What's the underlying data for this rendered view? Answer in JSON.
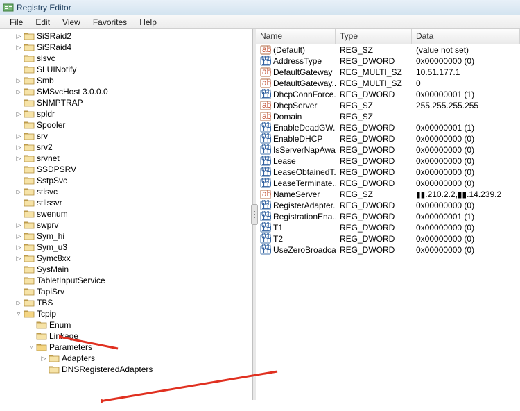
{
  "window": {
    "title": "Registry Editor"
  },
  "menu": [
    "File",
    "Edit",
    "View",
    "Favorites",
    "Help"
  ],
  "tree": [
    {
      "indent": 1,
      "exp": "▷",
      "label": "SiSRaid2"
    },
    {
      "indent": 1,
      "exp": "▷",
      "label": "SiSRaid4"
    },
    {
      "indent": 1,
      "exp": "",
      "label": "slsvc"
    },
    {
      "indent": 1,
      "exp": "",
      "label": "SLUINotify"
    },
    {
      "indent": 1,
      "exp": "▷",
      "label": "Smb"
    },
    {
      "indent": 1,
      "exp": "▷",
      "label": "SMSvcHost 3.0.0.0"
    },
    {
      "indent": 1,
      "exp": "",
      "label": "SNMPTRAP"
    },
    {
      "indent": 1,
      "exp": "▷",
      "label": "spldr"
    },
    {
      "indent": 1,
      "exp": "",
      "label": "Spooler"
    },
    {
      "indent": 1,
      "exp": "▷",
      "label": "srv"
    },
    {
      "indent": 1,
      "exp": "▷",
      "label": "srv2"
    },
    {
      "indent": 1,
      "exp": "▷",
      "label": "srvnet"
    },
    {
      "indent": 1,
      "exp": "",
      "label": "SSDPSRV"
    },
    {
      "indent": 1,
      "exp": "",
      "label": "SstpSvc"
    },
    {
      "indent": 1,
      "exp": "▷",
      "label": "stisvc"
    },
    {
      "indent": 1,
      "exp": "",
      "label": "stllssvr"
    },
    {
      "indent": 1,
      "exp": "",
      "label": "swenum"
    },
    {
      "indent": 1,
      "exp": "▷",
      "label": "swprv"
    },
    {
      "indent": 1,
      "exp": "▷",
      "label": "Sym_hi"
    },
    {
      "indent": 1,
      "exp": "▷",
      "label": "Sym_u3"
    },
    {
      "indent": 1,
      "exp": "▷",
      "label": "Symc8xx"
    },
    {
      "indent": 1,
      "exp": "",
      "label": "SysMain"
    },
    {
      "indent": 1,
      "exp": "",
      "label": "TabletInputService"
    },
    {
      "indent": 1,
      "exp": "",
      "label": "TapiSrv"
    },
    {
      "indent": 1,
      "exp": "▷",
      "label": "TBS"
    },
    {
      "indent": 1,
      "exp": "▿",
      "label": "Tcpip",
      "open": true
    },
    {
      "indent": 2,
      "exp": "",
      "label": "Enum"
    },
    {
      "indent": 2,
      "exp": "",
      "label": "Linkage"
    },
    {
      "indent": 2,
      "exp": "▿",
      "label": "Parameters",
      "open": true
    },
    {
      "indent": 3,
      "exp": "▷",
      "label": "Adapters"
    },
    {
      "indent": 3,
      "exp": "",
      "label": "DNSRegisteredAdapters"
    }
  ],
  "columns": {
    "name": "Name",
    "type": "Type",
    "data": "Data"
  },
  "values": [
    {
      "kind": "sz",
      "name": "(Default)",
      "type": "REG_SZ",
      "data": "(value not set)"
    },
    {
      "kind": "bin",
      "name": "AddressType",
      "type": "REG_DWORD",
      "data": "0x00000000 (0)"
    },
    {
      "kind": "sz",
      "name": "DefaultGateway",
      "type": "REG_MULTI_SZ",
      "data": "10.51.177.1"
    },
    {
      "kind": "sz",
      "name": "DefaultGateway...",
      "type": "REG_MULTI_SZ",
      "data": "0"
    },
    {
      "kind": "bin",
      "name": "DhcpConnForce...",
      "type": "REG_DWORD",
      "data": "0x00000001 (1)"
    },
    {
      "kind": "sz",
      "name": "DhcpServer",
      "type": "REG_SZ",
      "data": "255.255.255.255"
    },
    {
      "kind": "sz",
      "name": "Domain",
      "type": "REG_SZ",
      "data": ""
    },
    {
      "kind": "bin",
      "name": "EnableDeadGW...",
      "type": "REG_DWORD",
      "data": "0x00000001 (1)"
    },
    {
      "kind": "bin",
      "name": "EnableDHCP",
      "type": "REG_DWORD",
      "data": "0x00000000 (0)"
    },
    {
      "kind": "bin",
      "name": "IsServerNapAware",
      "type": "REG_DWORD",
      "data": "0x00000000 (0)"
    },
    {
      "kind": "bin",
      "name": "Lease",
      "type": "REG_DWORD",
      "data": "0x00000000 (0)"
    },
    {
      "kind": "bin",
      "name": "LeaseObtainedT...",
      "type": "REG_DWORD",
      "data": "0x00000000 (0)"
    },
    {
      "kind": "bin",
      "name": "LeaseTerminate...",
      "type": "REG_DWORD",
      "data": "0x00000000 (0)"
    },
    {
      "kind": "sz",
      "name": "NameServer",
      "type": "REG_SZ",
      "data": "▮▮.210.2.2,▮▮.14.239.2"
    },
    {
      "kind": "bin",
      "name": "RegisterAdapter...",
      "type": "REG_DWORD",
      "data": "0x00000000 (0)"
    },
    {
      "kind": "bin",
      "name": "RegistrationEna...",
      "type": "REG_DWORD",
      "data": "0x00000001 (1)"
    },
    {
      "kind": "bin",
      "name": "T1",
      "type": "REG_DWORD",
      "data": "0x00000000 (0)"
    },
    {
      "kind": "bin",
      "name": "T2",
      "type": "REG_DWORD",
      "data": "0x00000000 (0)"
    },
    {
      "kind": "bin",
      "name": "UseZeroBroadcast",
      "type": "REG_DWORD",
      "data": "0x00000000 (0)"
    }
  ]
}
